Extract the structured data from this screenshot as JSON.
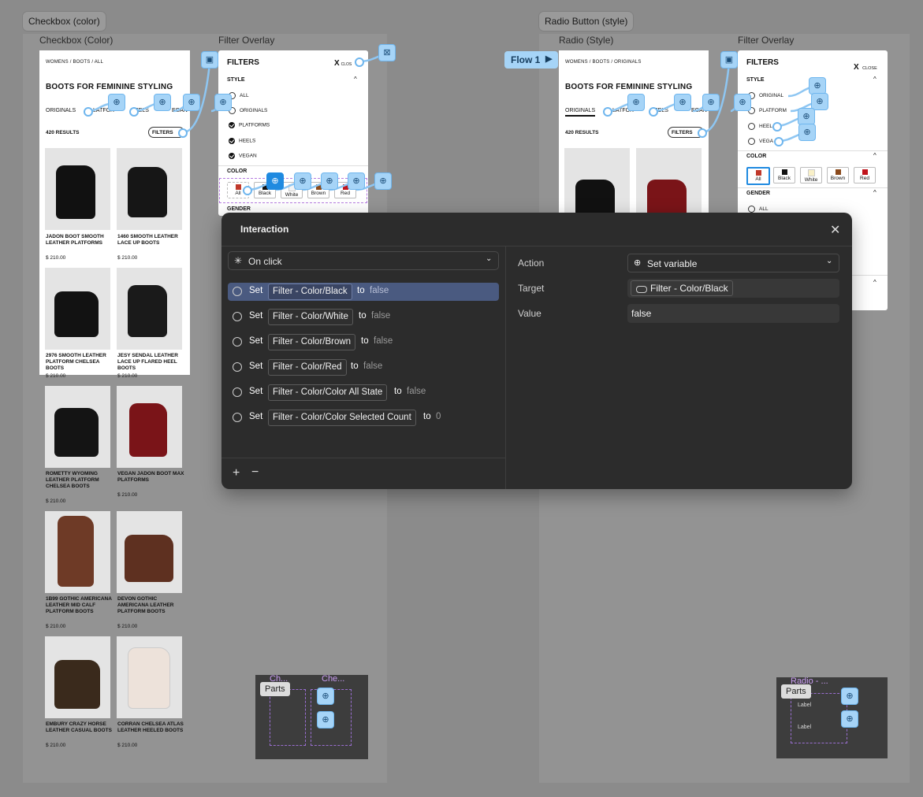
{
  "sections": {
    "left_tag": "Checkbox (color)",
    "right_tag": "Radio Button (style)"
  },
  "frames": {
    "left_main_label": "Checkbox (Color)",
    "left_overlay_label": "Filter Overlay",
    "right_main_label": "Radio (Style)",
    "right_overlay_label": "Filter Overlay"
  },
  "shop": {
    "breadcrumb_all": "WOMENS / BOOTS / ALL",
    "breadcrumb_originals": "WOMENS / BOOTS / ORIGINALS",
    "heading": "BOOTS FOR FEMININE STYLING",
    "tabs_left": [
      "ORIGINALS",
      "PLATFORMS",
      "HEELS",
      "VEGAN"
    ],
    "tabs_left_visible": [
      "ORIGINALS",
      "LATFOR",
      "EELS",
      "EGAN"
    ],
    "results": "420 RESULTS",
    "filters_btn": "FILTERS",
    "products": [
      {
        "name": "JADON BOOT SMOOTH LEATHER PLATFORMS",
        "price": "$ 210.00",
        "color": "#111111"
      },
      {
        "name": "1460 SMOOTH LEATHER LACE UP BOOTS",
        "price": "$ 210.00",
        "color": "#161616"
      },
      {
        "name": "2976 SMOOTH LEATHER PLATFORM CHELSEA BOOTS",
        "price": "$ 210.00",
        "color": "#121212"
      },
      {
        "name": "JESY SENDAL LEATHER LACE UP FLARED HEEL BOOTS",
        "price": "$ 210.00",
        "color": "#1a1a1a"
      },
      {
        "name": "ROMETTY WYOMING LEATHER PLATFORM CHELSEA BOOTS",
        "price": "$ 210.00",
        "color": "#141414"
      },
      {
        "name": "VEGAN JADON BOOT MAX PLATFORMS",
        "price": "$ 210.00",
        "color": "#7a1418"
      },
      {
        "name": "1B99 GOTHIC AMERICANA LEATHER MID CALF PLATFORM BOOTS",
        "price": "$ 210.00",
        "color": "#6e3a26"
      },
      {
        "name": "DEVON GOTHIC AMERICANA LEATHER PLATFORM BOOTS",
        "price": "$ 210.00",
        "color": "#5e3020"
      },
      {
        "name": "EMBURY CRAZY HORSE LEATHER CASUAL BOOTS",
        "price": "$ 210.00",
        "color": "#3a2a1c"
      },
      {
        "name": "CORRAN CHELSEA ATLAS LEATHER HEELED BOOTS",
        "price": "$ 210.00",
        "color": "#ede2da"
      }
    ]
  },
  "filters": {
    "title": "FILTERS",
    "close": "CLOSE",
    "close_left": "CLOS",
    "style_label": "STYLE",
    "style_options": [
      "ALL",
      "ORIGINALS",
      "PLATFORMS",
      "HEELS",
      "VEGAN"
    ],
    "style_options_right": [
      "ORIGINAL",
      "PLATFORM",
      "HEEL",
      "VEGA"
    ],
    "color_label": "COLOR",
    "color_options": [
      {
        "label": "All",
        "sq": "#c0392b"
      },
      {
        "label": "Black",
        "sq": "#111111"
      },
      {
        "label": "White",
        "sq": "#f4f4f4"
      },
      {
        "label": "Brown",
        "sq": "#8a4a1c"
      },
      {
        "label": "Red",
        "sq": "#c0141c"
      }
    ],
    "gender_label": "GENDER",
    "gender_all": "ALL"
  },
  "flow": {
    "label": "Flow 1"
  },
  "interaction": {
    "title": "Interaction",
    "trigger": "On click",
    "actions": [
      {
        "verb": "Set",
        "target": "Filter - Color/Black",
        "to": "to",
        "value": "false"
      },
      {
        "verb": "Set",
        "target": "Filter - Color/White",
        "to": "to",
        "value": "false"
      },
      {
        "verb": "Set",
        "target": "Filter - Color/Brown",
        "to": "to",
        "value": "false"
      },
      {
        "verb": "Set",
        "target": "Filter - Color/Red",
        "to": "to",
        "value": "false"
      },
      {
        "verb": "Set",
        "target": "Filter - Color/Color All State",
        "to": "to",
        "value": "false"
      },
      {
        "verb": "Set",
        "target": "Filter - Color/Color Selected Count",
        "to": "to",
        "value": "0"
      }
    ],
    "add": "+",
    "remove": "−",
    "props": {
      "action_label": "Action",
      "action_value": "Set variable",
      "target_label": "Target",
      "target_value": "Filter - Color/Black",
      "value_label": "Value",
      "value_value": "false"
    }
  },
  "parts": {
    "tag": "Parts",
    "left_title_a": "Ch...",
    "left_title_b": "Che...",
    "right_title": "Radio - ...",
    "right_label_a": "Label",
    "right_label_b": "Label"
  },
  "colors": {
    "accent": "#a6d4f7",
    "panel_bg": "#2c2c2c",
    "selected_row": "#4a5a80"
  }
}
